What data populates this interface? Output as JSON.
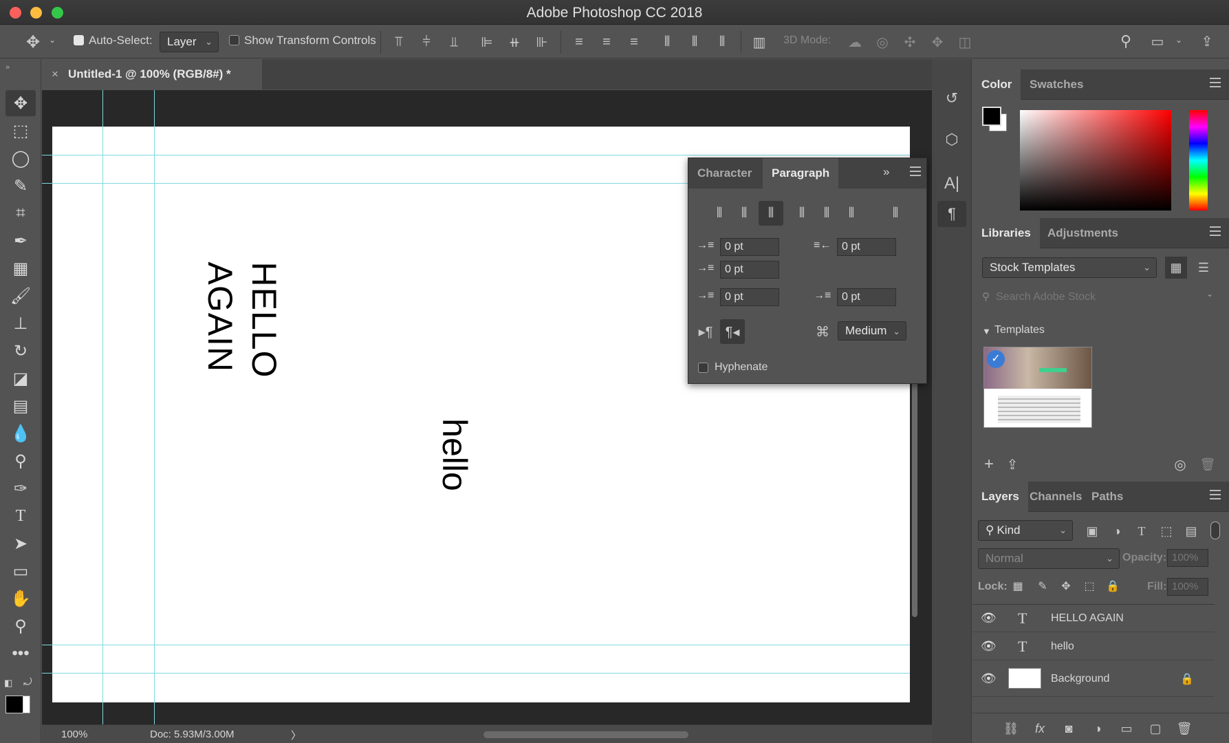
{
  "app": {
    "title": "Adobe Photoshop CC 2018"
  },
  "options": {
    "auto_select_label": "Auto-Select:",
    "auto_select_value": "Layer",
    "show_transform_label": "Show Transform Controls",
    "mode_3d_label": "3D Mode:"
  },
  "document": {
    "tab_title": "Untitled-1 @ 100% (RGB/8#) *",
    "close_glyph": "×"
  },
  "canvas_text": {
    "hello_again_line1": "HELLO",
    "hello_again_line2": "AGAIN",
    "hello": "hello"
  },
  "status": {
    "zoom": "100%",
    "doc_size": "Doc: 5.93M/3.00M",
    "arrow": "〉"
  },
  "paragraph_panel": {
    "tabs": [
      "Character",
      "Paragraph"
    ],
    "indent_left": "0 pt",
    "indent_right": "0 pt",
    "indent_first": "0 pt",
    "space_before": "0 pt",
    "space_after": "0 pt",
    "composer": "Medium",
    "hyphenate_label": "Hyphenate",
    "collapse_glyph": "»"
  },
  "color_panel": {
    "tabs": [
      "Color",
      "Swatches"
    ],
    "foreground": "#000000",
    "background": "#ffffff"
  },
  "libraries_panel": {
    "tabs": [
      "Libraries",
      "Adjustments"
    ],
    "library_select": "Stock Templates",
    "search_placeholder": "Search Adobe Stock",
    "section": "Templates"
  },
  "layers_panel": {
    "tabs": [
      "Layers",
      "Channels",
      "Paths"
    ],
    "filter_kind": "Kind",
    "blend_mode": "Normal",
    "opacity_label": "Opacity:",
    "opacity_value": "100%",
    "lock_label": "Lock:",
    "fill_label": "Fill:",
    "fill_value": "100%",
    "layers": [
      {
        "name": "HELLO  AGAIN",
        "kind": "text"
      },
      {
        "name": "hello",
        "kind": "text"
      },
      {
        "name": "Background",
        "kind": "pixel",
        "locked": true
      }
    ]
  },
  "colors": {
    "guide": "#7fd9e0",
    "ui_bg": "#535353"
  }
}
